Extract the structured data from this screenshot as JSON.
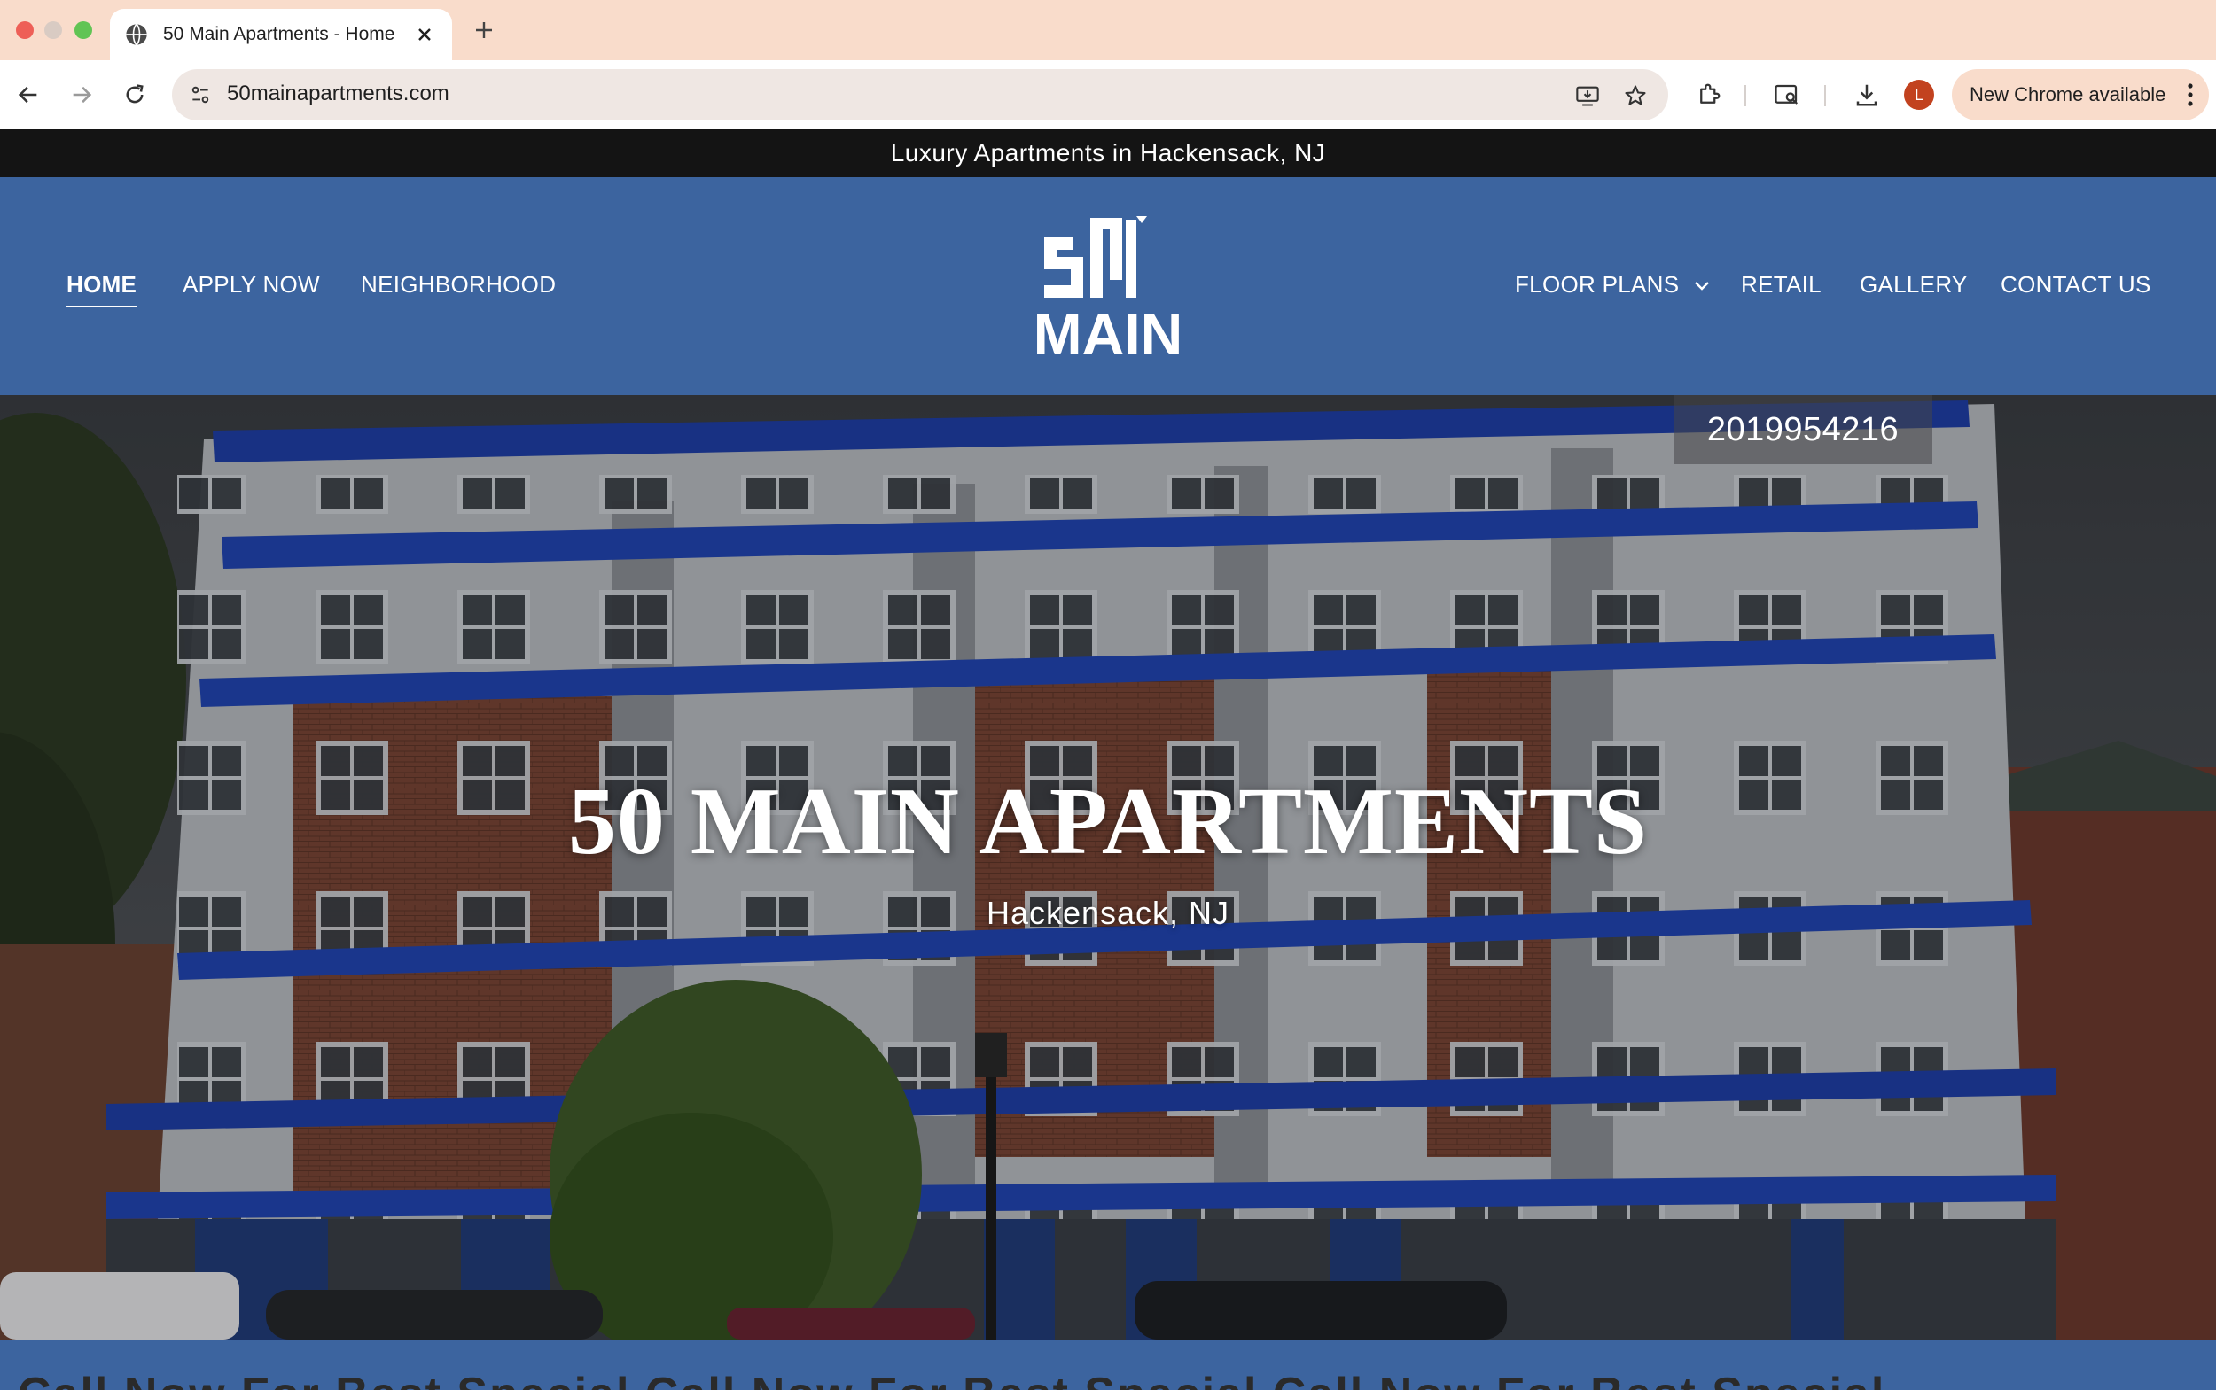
{
  "browser": {
    "tab": {
      "title": "50 Main Apartments - Home"
    },
    "address_bar": {
      "url": "50mainapartments.com"
    },
    "profile_initial": "L",
    "update_button": {
      "label": "New Chrome available"
    }
  },
  "site": {
    "announcement": "Luxury Apartments in Hackensack, NJ",
    "nav_left": [
      "HOME",
      "APPLY NOW",
      "NEIGHBORHOOD"
    ],
    "nav_right": [
      "FLOOR PLANS",
      "RETAIL",
      "GALLERY",
      "CONTACT US"
    ],
    "logo": {
      "number": "50",
      "word": "MAIN"
    },
    "hero": {
      "phone": "2019954216",
      "title": "50 MAIN APARTMENTS",
      "subtitle": "Hackensack, NJ"
    },
    "ticker": "Call Now For Best Special    Call Now For Best Special    Call Now For Best Special"
  },
  "colors": {
    "brand_blue": "#3c649f",
    "announcement_bar": "#141414",
    "tab_strip": "#f9dccb"
  }
}
